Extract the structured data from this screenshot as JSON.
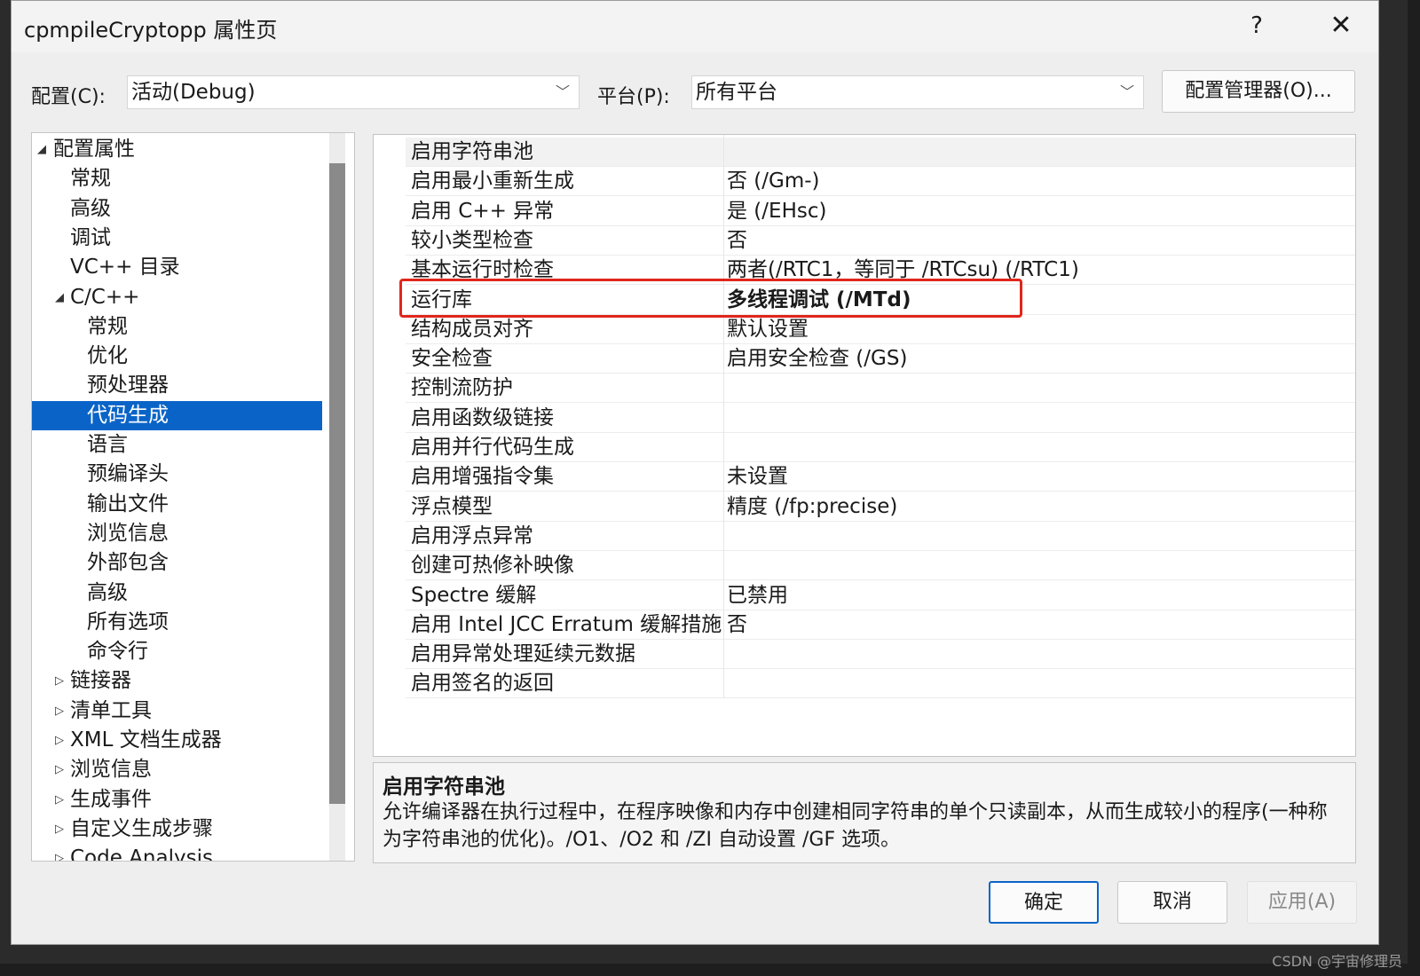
{
  "window": {
    "title": "cpmpileCryptopp 属性页",
    "help_glyph": "?",
    "close_glyph": "✕"
  },
  "toolbar": {
    "config_label": "配置(C):",
    "config_value": "活动(Debug)",
    "platform_label": "平台(P):",
    "platform_value": "所有平台",
    "config_manager_label": "配置管理器(O)..."
  },
  "tree": {
    "items": [
      {
        "label": "配置属性",
        "expander": "◢"
      },
      {
        "label": "常规"
      },
      {
        "label": "高级"
      },
      {
        "label": "调试"
      },
      {
        "label": "VC++ 目录"
      },
      {
        "label": "C/C++",
        "expander": "◢"
      },
      {
        "label": "常规"
      },
      {
        "label": "优化"
      },
      {
        "label": "预处理器"
      },
      {
        "label": "代码生成",
        "selected": true
      },
      {
        "label": "语言"
      },
      {
        "label": "预编译头"
      },
      {
        "label": "输出文件"
      },
      {
        "label": "浏览信息"
      },
      {
        "label": "外部包含"
      },
      {
        "label": "高级"
      },
      {
        "label": "所有选项"
      },
      {
        "label": "命令行"
      },
      {
        "label": "链接器",
        "expander": "▷"
      },
      {
        "label": "清单工具",
        "expander": "▷"
      },
      {
        "label": "XML 文档生成器",
        "expander": "▷"
      },
      {
        "label": "浏览信息",
        "expander": "▷"
      },
      {
        "label": "生成事件",
        "expander": "▷"
      },
      {
        "label": "自定义生成步骤",
        "expander": "▷"
      },
      {
        "label": "Code Analysis",
        "expander": "▷"
      }
    ]
  },
  "grid": {
    "rows": [
      {
        "name": "启用字符串池",
        "value": ""
      },
      {
        "name": "启用最小重新生成",
        "value": "否 (/Gm-)"
      },
      {
        "name": "启用 C++ 异常",
        "value": "是 (/EHsc)"
      },
      {
        "name": "较小类型检查",
        "value": "否"
      },
      {
        "name": "基本运行时检查",
        "value": "两者(/RTC1，等同于 /RTCsu) (/RTC1)"
      },
      {
        "name": "运行库",
        "value": "多线程调试 (/MTd)",
        "bold": true
      },
      {
        "name": "结构成员对齐",
        "value": "默认设置"
      },
      {
        "name": "安全检查",
        "value": "启用安全检查 (/GS)"
      },
      {
        "name": "控制流防护",
        "value": ""
      },
      {
        "name": "启用函数级链接",
        "value": ""
      },
      {
        "name": "启用并行代码生成",
        "value": ""
      },
      {
        "name": "启用增强指令集",
        "value": "未设置"
      },
      {
        "name": "浮点模型",
        "value": "精度 (/fp:precise)"
      },
      {
        "name": "启用浮点异常",
        "value": ""
      },
      {
        "name": "创建可热修补映像",
        "value": ""
      },
      {
        "name": "Spectre 缓解",
        "value": "已禁用"
      },
      {
        "name": "启用 Intel JCC Erratum 缓解措施",
        "value": "否"
      },
      {
        "name": "启用异常处理延续元数据",
        "value": ""
      },
      {
        "name": "启用签名的返回",
        "value": ""
      }
    ],
    "highlight_color": "#e0261b"
  },
  "description": {
    "title": "启用字符串池",
    "body": "允许编译器在执行过程中，在程序映像和内存中创建相同字符串的单个只读副本，从而生成较小的程序(一种称为字符串池的优化)。/O1、/O2 和 /ZI 自动设置 /GF 选项。"
  },
  "buttons": {
    "ok": "确定",
    "cancel": "取消",
    "apply": "应用(A)"
  },
  "watermark": "CSDN @宇宙修理员",
  "colors": {
    "selection": "#0a64c8",
    "ok_border": "#0a64c8",
    "disabled_text": "#8a8a8a"
  }
}
